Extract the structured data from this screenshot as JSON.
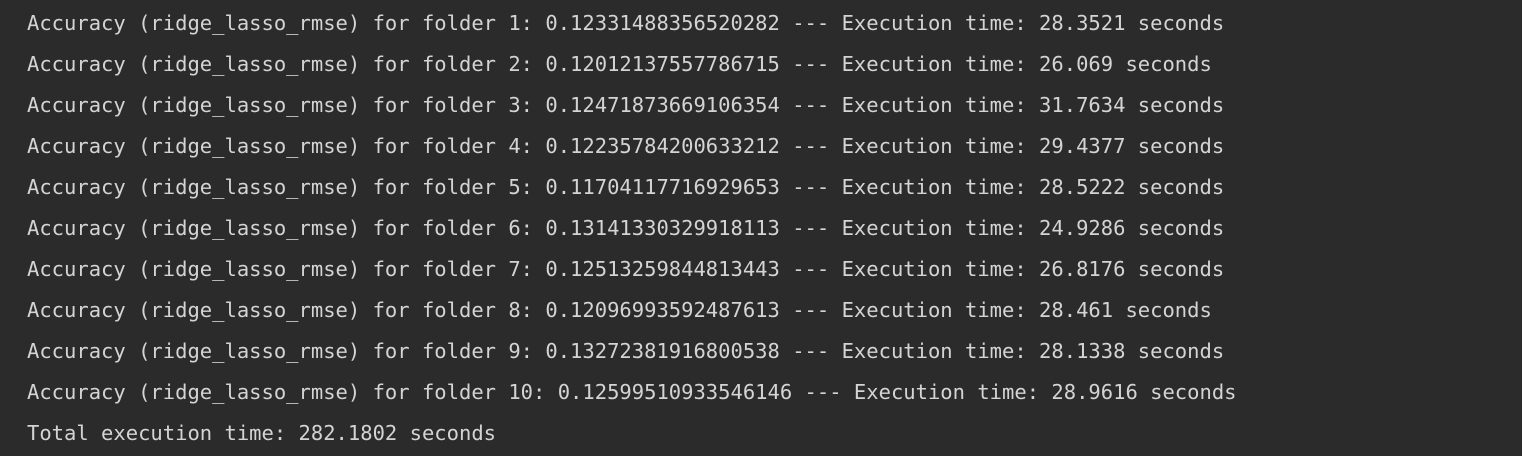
{
  "console": {
    "lines": [
      "Accuracy (ridge_lasso_rmse) for folder 1: 0.12331488356520282 --- Execution time: 28.3521 seconds",
      "Accuracy (ridge_lasso_rmse) for folder 2: 0.12012137557786715 --- Execution time: 26.069 seconds",
      "Accuracy (ridge_lasso_rmse) for folder 3: 0.12471873669106354 --- Execution time: 31.7634 seconds",
      "Accuracy (ridge_lasso_rmse) for folder 4: 0.12235784200633212 --- Execution time: 29.4377 seconds",
      "Accuracy (ridge_lasso_rmse) for folder 5: 0.11704117716929653 --- Execution time: 28.5222 seconds",
      "Accuracy (ridge_lasso_rmse) for folder 6: 0.13141330329918113 --- Execution time: 24.9286 seconds",
      "Accuracy (ridge_lasso_rmse) for folder 7: 0.12513259844813443 --- Execution time: 26.8176 seconds",
      "Accuracy (ridge_lasso_rmse) for folder 8: 0.12096993592487613 --- Execution time: 28.461 seconds",
      "Accuracy (ridge_lasso_rmse) for folder 9: 0.13272381916800538 --- Execution time: 28.1338 seconds",
      "Accuracy (ridge_lasso_rmse) for folder 10: 0.12599510933546146 --- Execution time: 28.9616 seconds",
      "Total execution time: 282.1802 seconds"
    ]
  },
  "colors": {
    "background": "#2b2b2b",
    "text": "#d4d4d4"
  }
}
